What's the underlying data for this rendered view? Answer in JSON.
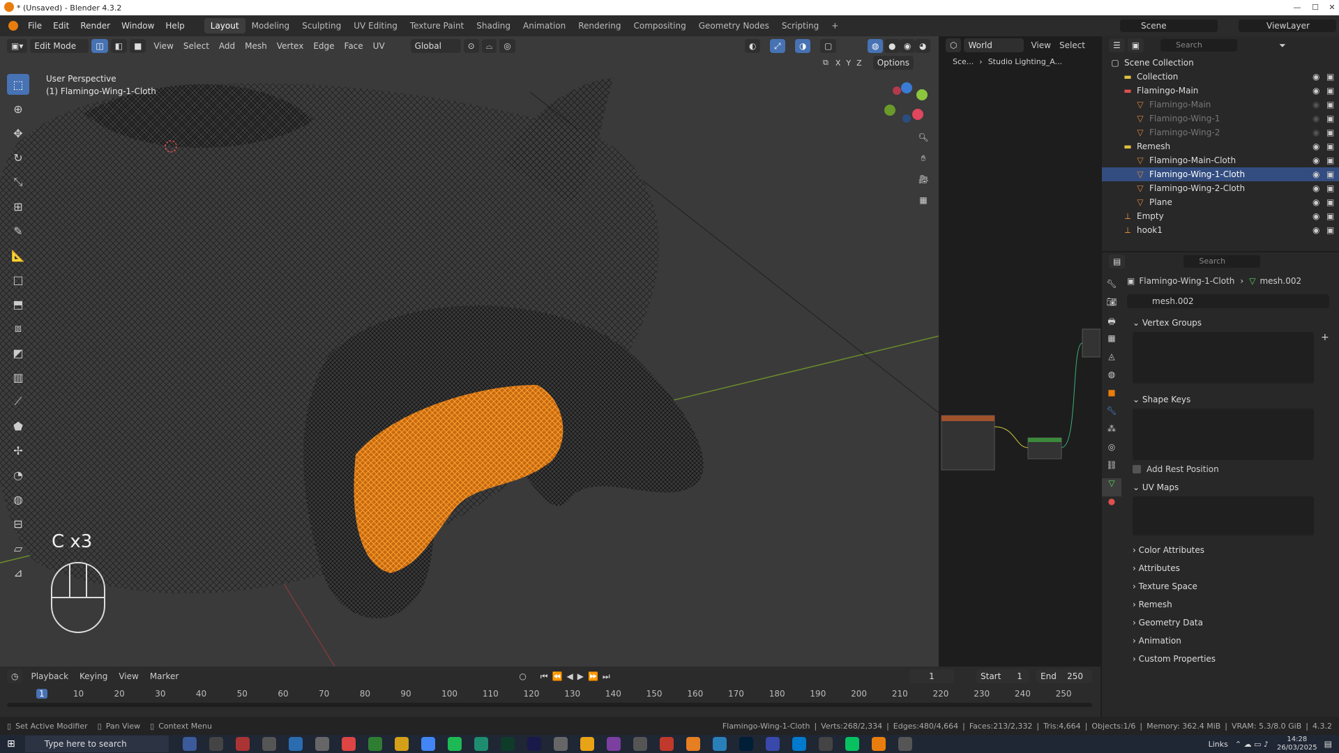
{
  "window": {
    "title": "* (Unsaved) - Blender 4.3.2"
  },
  "menu": [
    "File",
    "Edit",
    "Render",
    "Window",
    "Help"
  ],
  "workspaces": [
    "Layout",
    "Modeling",
    "Sculpting",
    "UV Editing",
    "Texture Paint",
    "Shading",
    "Animation",
    "Rendering",
    "Compositing",
    "Geometry Nodes",
    "Scripting"
  ],
  "active_workspace": "Layout",
  "scene": {
    "name": "Scene",
    "view_layer": "ViewLayer"
  },
  "viewport": {
    "mode": "Edit Mode",
    "menus": [
      "View",
      "Select",
      "Add",
      "Mesh",
      "Vertex",
      "Edge",
      "Face",
      "UV"
    ],
    "orientation": "Global",
    "options_label": "Options",
    "axes": [
      "X",
      "Y",
      "Z"
    ],
    "overlay_title": "User Perspective",
    "overlay_object": "(1) Flamingo-Wing-1-Cloth",
    "key_display": "C x3"
  },
  "node_editor": {
    "world_label": "World",
    "view": "View",
    "select": "Select",
    "breadcrumb_scene": "Sce...",
    "breadcrumb_world": "Studio Lighting_A..."
  },
  "outliner": {
    "search_placeholder": "Search",
    "rows": [
      {
        "label": "Scene Collection",
        "indent": 0,
        "kind": "scene"
      },
      {
        "label": "Collection",
        "indent": 1,
        "kind": "collection"
      },
      {
        "label": "Flamingo-Main",
        "indent": 1,
        "kind": "collection"
      },
      {
        "label": "Flamingo-Main",
        "indent": 2,
        "kind": "mesh-dim"
      },
      {
        "label": "Flamingo-Wing-1",
        "indent": 2,
        "kind": "mesh-dim"
      },
      {
        "label": "Flamingo-Wing-2",
        "indent": 2,
        "kind": "mesh-dim"
      },
      {
        "label": "Remesh",
        "indent": 1,
        "kind": "collection"
      },
      {
        "label": "Flamingo-Main-Cloth",
        "indent": 2,
        "kind": "mesh"
      },
      {
        "label": "Flamingo-Wing-1-Cloth",
        "indent": 2,
        "kind": "mesh-selected"
      },
      {
        "label": "Flamingo-Wing-2-Cloth",
        "indent": 2,
        "kind": "mesh"
      },
      {
        "label": "Plane",
        "indent": 2,
        "kind": "mesh"
      },
      {
        "label": "Empty",
        "indent": 1,
        "kind": "empty"
      },
      {
        "label": "hook1",
        "indent": 1,
        "kind": "empty"
      }
    ]
  },
  "properties": {
    "search_placeholder": "Search",
    "breadcrumb_object": "Flamingo-Wing-1-Cloth",
    "breadcrumb_mesh": "mesh.002",
    "datablock": "mesh.002",
    "sections_open": [
      "Vertex Groups",
      "Shape Keys",
      "UV Maps"
    ],
    "add_rest_position": "Add Rest Position",
    "sections_closed": [
      "Color Attributes",
      "Attributes",
      "Texture Space",
      "Remesh",
      "Geometry Data",
      "Animation",
      "Custom Properties"
    ]
  },
  "timeline": {
    "menus": [
      "Playback",
      "Keying",
      "View",
      "Marker"
    ],
    "current_frame": "1",
    "start_label": "Start",
    "start": "1",
    "end_label": "End",
    "end": "250",
    "ticks": [
      "1",
      "10",
      "20",
      "30",
      "40",
      "50",
      "60",
      "70",
      "80",
      "90",
      "100",
      "110",
      "120",
      "130",
      "140",
      "150",
      "160",
      "170",
      "180",
      "190",
      "200",
      "210",
      "220",
      "230",
      "240",
      "250"
    ]
  },
  "statusbar": {
    "left": [
      "Set Active Modifier",
      "Pan View",
      "Context Menu"
    ],
    "object": "Flamingo-Wing-1-Cloth",
    "verts": "Verts:268/2,334",
    "edges": "Edges:480/4,664",
    "faces": "Faces:213/2,332",
    "tris": "Tris:4,664",
    "objects": "Objects:1/6",
    "memory": "Memory: 362.4 MiB",
    "vram": "VRAM: 5.3/8.0 GiB",
    "version": "4.3.2"
  },
  "taskbar": {
    "search_placeholder": "Type here to search",
    "links": "Links",
    "time": "14:28",
    "date": "26/03/2025"
  },
  "colors": {
    "accent": "#4772b3",
    "selection": "#ff8c1a",
    "viewport_bg": "#3a3a3a"
  }
}
